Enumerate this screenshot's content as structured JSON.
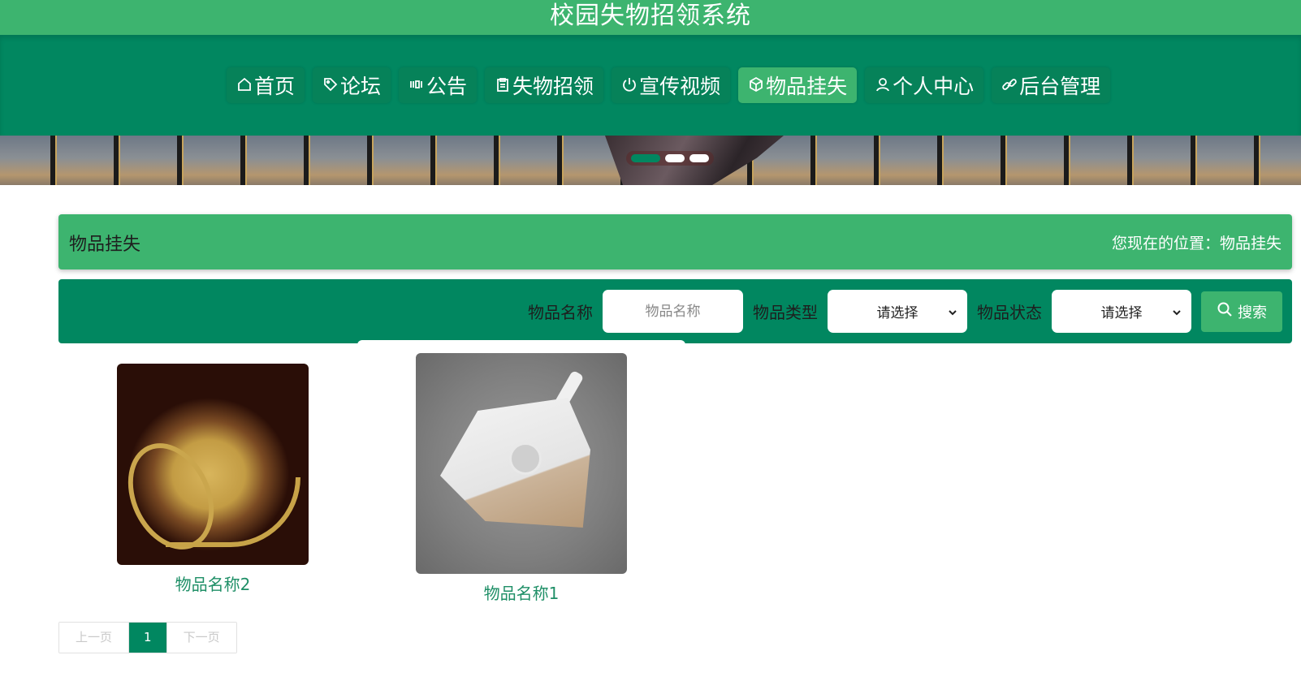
{
  "app": {
    "title": "校园失物招领系统"
  },
  "nav": {
    "items": [
      {
        "label": "首页",
        "icon": "home-icon"
      },
      {
        "label": "论坛",
        "icon": "tag-icon"
      },
      {
        "label": "公告",
        "icon": "notice-icon"
      },
      {
        "label": "失物招领",
        "icon": "clipboard-icon"
      },
      {
        "label": "宣传视频",
        "icon": "power-icon"
      },
      {
        "label": "物品挂失",
        "icon": "box-icon",
        "active": true
      },
      {
        "label": "个人中心",
        "icon": "user-icon"
      },
      {
        "label": "后台管理",
        "icon": "link-icon"
      }
    ]
  },
  "carousel": {
    "slides": 3,
    "active_index": 0
  },
  "section": {
    "title": "物品挂失",
    "breadcrumb": "您现在的位置：物品挂失"
  },
  "search": {
    "name_label": "物品名称",
    "name_placeholder": "物品名称",
    "name_value": "",
    "type_label": "物品类型",
    "type_selected": "请选择",
    "status_label": "物品状态",
    "status_selected": "请选择",
    "button_label": "搜索"
  },
  "items": [
    {
      "name": "物品名称2",
      "image": "basket-photo"
    },
    {
      "name": "物品名称1",
      "image": "iron-photo"
    }
  ],
  "pagination": {
    "prev": "上一页",
    "current": "1",
    "next": "下一页"
  },
  "colors": {
    "primary": "#018760",
    "accent": "#3db46f",
    "link": "#1f8f67"
  }
}
